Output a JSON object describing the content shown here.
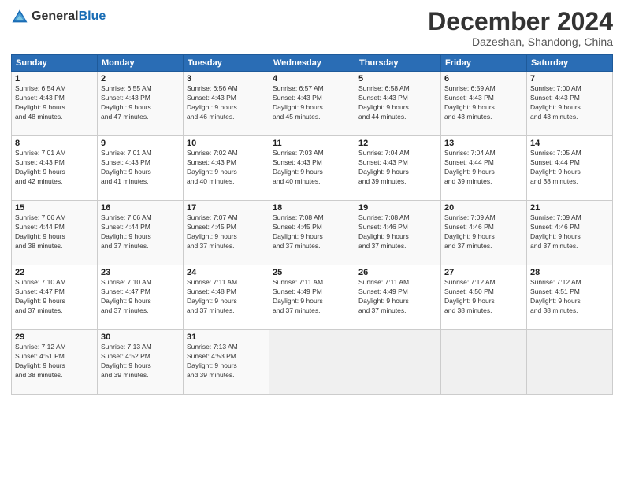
{
  "header": {
    "logo_general": "General",
    "logo_blue": "Blue",
    "month_title": "December 2024",
    "location": "Dazeshan, Shandong, China"
  },
  "days_of_week": [
    "Sunday",
    "Monday",
    "Tuesday",
    "Wednesday",
    "Thursday",
    "Friday",
    "Saturday"
  ],
  "weeks": [
    [
      {
        "day": "1",
        "sunrise": "6:54 AM",
        "sunset": "4:43 PM",
        "daylight": "9 hours and 48 minutes."
      },
      {
        "day": "2",
        "sunrise": "6:55 AM",
        "sunset": "4:43 PM",
        "daylight": "9 hours and 47 minutes."
      },
      {
        "day": "3",
        "sunrise": "6:56 AM",
        "sunset": "4:43 PM",
        "daylight": "9 hours and 46 minutes."
      },
      {
        "day": "4",
        "sunrise": "6:57 AM",
        "sunset": "4:43 PM",
        "daylight": "9 hours and 45 minutes."
      },
      {
        "day": "5",
        "sunrise": "6:58 AM",
        "sunset": "4:43 PM",
        "daylight": "9 hours and 44 minutes."
      },
      {
        "day": "6",
        "sunrise": "6:59 AM",
        "sunset": "4:43 PM",
        "daylight": "9 hours and 43 minutes."
      },
      {
        "day": "7",
        "sunrise": "7:00 AM",
        "sunset": "4:43 PM",
        "daylight": "9 hours and 43 minutes."
      }
    ],
    [
      {
        "day": "8",
        "sunrise": "7:01 AM",
        "sunset": "4:43 PM",
        "daylight": "9 hours and 42 minutes."
      },
      {
        "day": "9",
        "sunrise": "7:01 AM",
        "sunset": "4:43 PM",
        "daylight": "9 hours and 41 minutes."
      },
      {
        "day": "10",
        "sunrise": "7:02 AM",
        "sunset": "4:43 PM",
        "daylight": "9 hours and 40 minutes."
      },
      {
        "day": "11",
        "sunrise": "7:03 AM",
        "sunset": "4:43 PM",
        "daylight": "9 hours and 40 minutes."
      },
      {
        "day": "12",
        "sunrise": "7:04 AM",
        "sunset": "4:43 PM",
        "daylight": "9 hours and 39 minutes."
      },
      {
        "day": "13",
        "sunrise": "7:04 AM",
        "sunset": "4:44 PM",
        "daylight": "9 hours and 39 minutes."
      },
      {
        "day": "14",
        "sunrise": "7:05 AM",
        "sunset": "4:44 PM",
        "daylight": "9 hours and 38 minutes."
      }
    ],
    [
      {
        "day": "15",
        "sunrise": "7:06 AM",
        "sunset": "4:44 PM",
        "daylight": "9 hours and 38 minutes."
      },
      {
        "day": "16",
        "sunrise": "7:06 AM",
        "sunset": "4:44 PM",
        "daylight": "9 hours and 37 minutes."
      },
      {
        "day": "17",
        "sunrise": "7:07 AM",
        "sunset": "4:45 PM",
        "daylight": "9 hours and 37 minutes."
      },
      {
        "day": "18",
        "sunrise": "7:08 AM",
        "sunset": "4:45 PM",
        "daylight": "9 hours and 37 minutes."
      },
      {
        "day": "19",
        "sunrise": "7:08 AM",
        "sunset": "4:46 PM",
        "daylight": "9 hours and 37 minutes."
      },
      {
        "day": "20",
        "sunrise": "7:09 AM",
        "sunset": "4:46 PM",
        "daylight": "9 hours and 37 minutes."
      },
      {
        "day": "21",
        "sunrise": "7:09 AM",
        "sunset": "4:46 PM",
        "daylight": "9 hours and 37 minutes."
      }
    ],
    [
      {
        "day": "22",
        "sunrise": "7:10 AM",
        "sunset": "4:47 PM",
        "daylight": "9 hours and 37 minutes."
      },
      {
        "day": "23",
        "sunrise": "7:10 AM",
        "sunset": "4:47 PM",
        "daylight": "9 hours and 37 minutes."
      },
      {
        "day": "24",
        "sunrise": "7:11 AM",
        "sunset": "4:48 PM",
        "daylight": "9 hours and 37 minutes."
      },
      {
        "day": "25",
        "sunrise": "7:11 AM",
        "sunset": "4:49 PM",
        "daylight": "9 hours and 37 minutes."
      },
      {
        "day": "26",
        "sunrise": "7:11 AM",
        "sunset": "4:49 PM",
        "daylight": "9 hours and 37 minutes."
      },
      {
        "day": "27",
        "sunrise": "7:12 AM",
        "sunset": "4:50 PM",
        "daylight": "9 hours and 38 minutes."
      },
      {
        "day": "28",
        "sunrise": "7:12 AM",
        "sunset": "4:51 PM",
        "daylight": "9 hours and 38 minutes."
      }
    ],
    [
      {
        "day": "29",
        "sunrise": "7:12 AM",
        "sunset": "4:51 PM",
        "daylight": "9 hours and 38 minutes."
      },
      {
        "day": "30",
        "sunrise": "7:13 AM",
        "sunset": "4:52 PM",
        "daylight": "9 hours and 39 minutes."
      },
      {
        "day": "31",
        "sunrise": "7:13 AM",
        "sunset": "4:53 PM",
        "daylight": "9 hours and 39 minutes."
      },
      null,
      null,
      null,
      null
    ]
  ],
  "labels": {
    "sunrise": "Sunrise:",
    "sunset": "Sunset:",
    "daylight": "Daylight:"
  }
}
